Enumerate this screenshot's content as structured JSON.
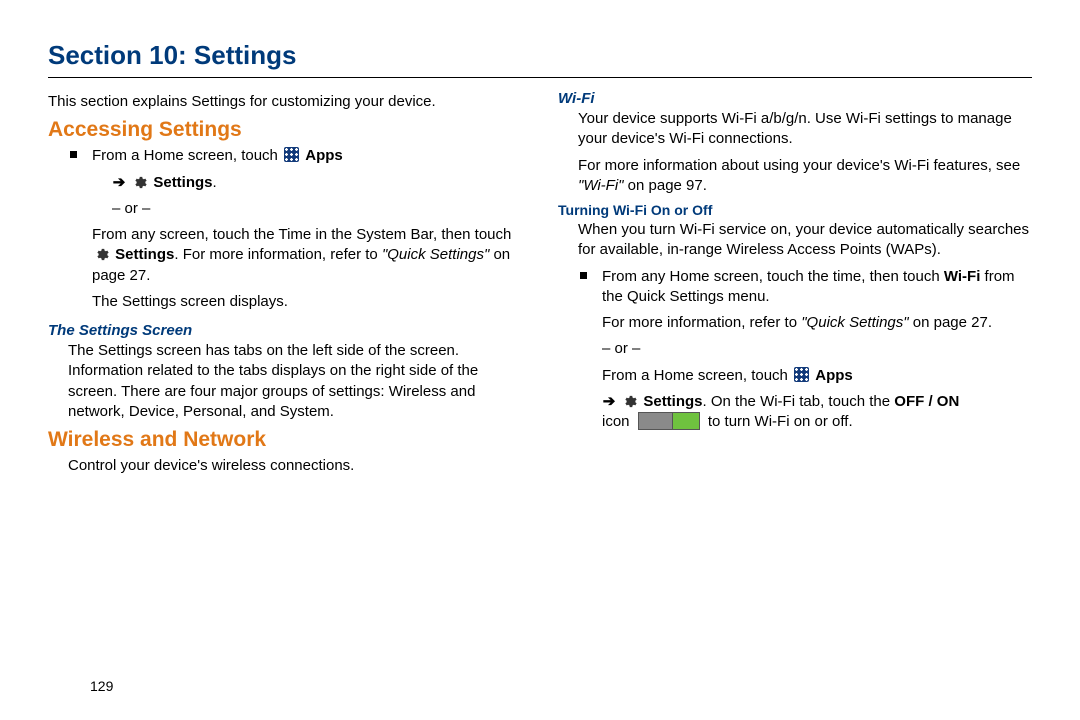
{
  "title": "Section 10: Settings",
  "intro": "This section explains Settings for customizing your device.",
  "h_accessing": "Accessing Settings",
  "acc_line1_pre": "From a Home screen, touch ",
  "apps_label": "Apps",
  "settings_label": "Settings",
  "or_text": "– or –",
  "acc_line2a": "From any screen, touch the Time in the System Bar, then touch ",
  "acc_line2b": ". For more information, refer to ",
  "quick_settings_ref": "\"Quick Settings\"",
  "acc_line2c": " on page 27.",
  "acc_line3": "The Settings screen displays.",
  "h_settings_screen": "The Settings Screen",
  "settings_screen_body": "The Settings screen has tabs on the left side of the screen. Information related to the tabs displays on the right side of the screen. There are four major groups of settings: Wireless and network, Device, Personal, and System.",
  "h_wireless": "Wireless and Network",
  "wireless_body": "Control your device's wireless connections.",
  "h_wifi": "Wi-Fi",
  "wifi_p1": "Your device supports Wi-Fi a/b/g/n. Use Wi-Fi settings to manage your device's Wi-Fi connections.",
  "wifi_p2a": "For more information about using your device's Wi-Fi features, see ",
  "wifi_ref": "\"Wi-Fi\"",
  "wifi_p2b": " on page 97.",
  "h_turning": "Turning Wi-Fi On or Off",
  "turning_p1": "When you turn Wi-Fi service on, your device automatically searches for available, in-range Wireless Access Points (WAPs).",
  "turning_b1a": "From any Home screen, touch the time, then touch ",
  "wifi_bold": "Wi-Fi",
  "turning_b1b": " from the Quick Settings menu.",
  "turning_b1c_a": "For more information, refer to ",
  "turning_b1c_b": " on page 27.",
  "turning_home_pre": "From a Home screen, touch ",
  "turning_last_a": ". On the Wi-Fi tab, touch the ",
  "off_on": "OFF / ON",
  "turning_last_b": "icon ",
  "turning_last_c": " to turn Wi-Fi on or off.",
  "page_number": "129",
  "arrow_glyph": "➔"
}
